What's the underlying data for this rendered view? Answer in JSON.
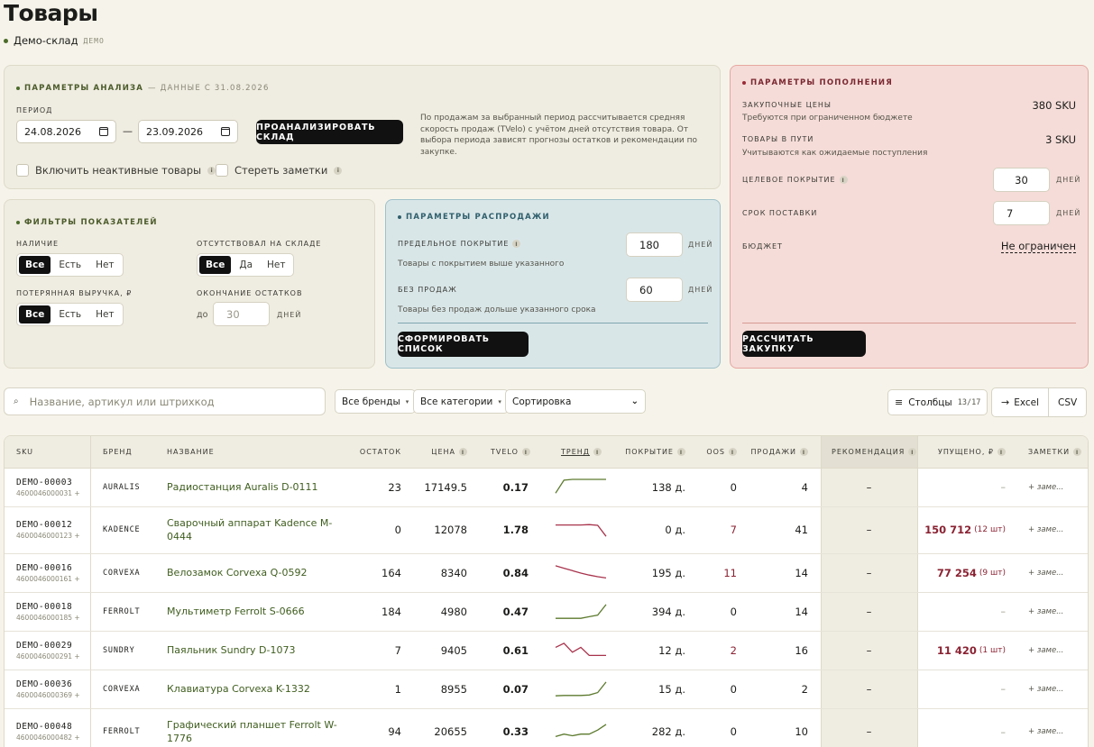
{
  "page": {
    "title": "Товары",
    "workspace": "Демо-склад",
    "workspace_tag": "ДЕМО"
  },
  "analysis": {
    "title": "Параметры анализа",
    "subtitle": "— данные с 31.08.2026",
    "period_label": "Период",
    "date_from": "24.08.2026",
    "date_to": "23.09.2026",
    "dash": "—",
    "analyze_button": "Проанализировать склад",
    "hint": "По продажам за выбранный период рассчитывается средняя скорость продаж (TVelo) с учётом дней отсутствия товара. От выбора периода зависят прогнозы остатков и рекомендации по закупке.",
    "include_inactive": "Включить неактивные товары",
    "clear_notes": "Стереть заметки"
  },
  "filters": {
    "title": "Фильтры показателей",
    "availability_label": "Наличие",
    "availability_options": [
      "Все",
      "Есть",
      "Нет"
    ],
    "oos_label": "Отсутствовал на складе",
    "oos_options": [
      "Все",
      "Да",
      "Нет"
    ],
    "lost_label": "Потерянная выручка, ₽",
    "lost_options": [
      "Все",
      "Есть",
      "Нет"
    ],
    "end_label": "Окончание остатков",
    "end_prefix": "до",
    "end_placeholder": "30",
    "end_unit": "дней"
  },
  "sale": {
    "title": "Параметры распродажи",
    "coverage_label": "Предельное покрытие",
    "coverage_value": "180",
    "coverage_unit": "дней",
    "coverage_hint": "Товары с покрытием выше указанного",
    "nosales_label": "Без продаж",
    "nosales_value": "60",
    "nosales_unit": "дней",
    "nosales_hint": "Товары без продаж дольше указанного срока",
    "button": "Сформировать список"
  },
  "refill": {
    "title": "Параметры пополнения",
    "prices_label": "Закупочные цены",
    "prices_value": "380 SKU",
    "prices_hint": "Требуются при ограниченном бюджете",
    "transit_label": "Товары в пути",
    "transit_value": "3 SKU",
    "transit_hint": "Учитываются как ожидаемые поступления",
    "target_label": "Целевое покрытие",
    "target_value": "30",
    "target_unit": "дней",
    "lead_label": "Срок поставки",
    "lead_value": "7",
    "lead_unit": "дней",
    "budget_label": "Бюджет",
    "budget_value": "Не ограничен",
    "button": "Рассчитать закупку"
  },
  "toolbar": {
    "search_placeholder": "Название, артикул или штрихкод",
    "brands": "Все бренды",
    "categories": "Все категории",
    "sort": "Сортировка",
    "columns": "Столбцы",
    "columns_count": "13/17",
    "excel": "Excel",
    "csv": "CSV"
  },
  "table": {
    "headers": [
      "SKU",
      "Бренд",
      "Название",
      "Остаток",
      "Цена",
      "TVelo",
      "Тренд",
      "Покрытие",
      "OOS",
      "Продажи",
      "Рекомендация",
      "Упущено, ₽",
      "Заметки"
    ],
    "rows": [
      {
        "sku": "DEMO-00003",
        "barcode": "4600046000031",
        "brand": "AURALIS",
        "name": "Радиостанция Auralis D-0111",
        "stock": "23",
        "price": "17149.5",
        "tvelo": "0.17",
        "trend": [
          0.15,
          0.95,
          1,
          1,
          1,
          1,
          1
        ],
        "trend_color": "#5c7a2e",
        "coverage": "138 д.",
        "oos": "0",
        "sales": "4",
        "rec": "–",
        "lost": "–",
        "lost_qty": "",
        "notes": "+ заме..."
      },
      {
        "sku": "DEMO-00012",
        "barcode": "4600046000123",
        "brand": "KADENCE",
        "name": "Сварочный аппарат Kadence M-0444",
        "stock": "0",
        "price": "12078",
        "tvelo": "1.78",
        "trend": [
          0.8,
          0.8,
          0.8,
          0.8,
          0.82,
          0.78,
          0.1
        ],
        "trend_color": "#a8334c",
        "coverage": "0 д.",
        "oos": "7",
        "sales": "41",
        "rec": "–",
        "lost": "150 712",
        "lost_qty": "(12 шт)",
        "notes": "+ заме..."
      },
      {
        "sku": "DEMO-00016",
        "barcode": "4600046000161",
        "brand": "CORVEXA",
        "name": "Велозамок Corvexa Q-0592",
        "stock": "164",
        "price": "8340",
        "tvelo": "0.84",
        "trend": [
          0.95,
          0.8,
          0.65,
          0.5,
          0.38,
          0.28,
          0.2
        ],
        "trend_color": "#a8334c",
        "coverage": "195 д.",
        "oos": "11",
        "sales": "14",
        "rec": "–",
        "lost": "77 254",
        "lost_qty": "(9 шт)",
        "notes": "+ заме..."
      },
      {
        "sku": "DEMO-00018",
        "barcode": "4600046000185",
        "brand": "FERROLT",
        "name": "Мультиметр Ferrolt S-0666",
        "stock": "184",
        "price": "4980",
        "tvelo": "0.47",
        "trend": [
          0.1,
          0.1,
          0.1,
          0.1,
          0.2,
          0.3,
          0.95
        ],
        "trend_color": "#5c7a2e",
        "coverage": "394 д.",
        "oos": "0",
        "sales": "14",
        "rec": "–",
        "lost": "–",
        "lost_qty": "",
        "notes": "+ заме..."
      },
      {
        "sku": "DEMO-00029",
        "barcode": "4600046000291",
        "brand": "SUNDRY",
        "name": "Паяльник Sundry D-1073",
        "stock": "7",
        "price": "9405",
        "tvelo": "0.61",
        "trend": [
          0.7,
          0.95,
          0.4,
          0.7,
          0.2,
          0.2,
          0.2
        ],
        "trend_color": "#a8334c",
        "coverage": "12 д.",
        "oos": "2",
        "sales": "16",
        "rec": "–",
        "lost": "11 420",
        "lost_qty": "(1 шт)",
        "notes": "+ заме..."
      },
      {
        "sku": "DEMO-00036",
        "barcode": "4600046000369",
        "brand": "CORVEXA",
        "name": "Клавиатура Corvexa K-1332",
        "stock": "1",
        "price": "8955",
        "tvelo": "0.07",
        "trend": [
          0.1,
          0.12,
          0.12,
          0.12,
          0.15,
          0.3,
          0.95
        ],
        "trend_color": "#5c7a2e",
        "coverage": "15 д.",
        "oos": "0",
        "sales": "2",
        "rec": "–",
        "lost": "–",
        "lost_qty": "",
        "notes": "+ заме..."
      },
      {
        "sku": "DEMO-00048",
        "barcode": "4600046000482",
        "brand": "FERROLT",
        "name": "Графический планшет Ferrolt W-1776",
        "stock": "94",
        "price": "20655",
        "tvelo": "0.33",
        "trend": [
          0.2,
          0.35,
          0.25,
          0.35,
          0.35,
          0.6,
          0.95
        ],
        "trend_color": "#5c7a2e",
        "coverage": "282 д.",
        "oos": "0",
        "sales": "10",
        "rec": "–",
        "lost": "–",
        "lost_qty": "",
        "notes": "+ заме..."
      }
    ]
  },
  "colors": {
    "accent_green": "#4b6b2a",
    "danger": "#8a2232"
  }
}
